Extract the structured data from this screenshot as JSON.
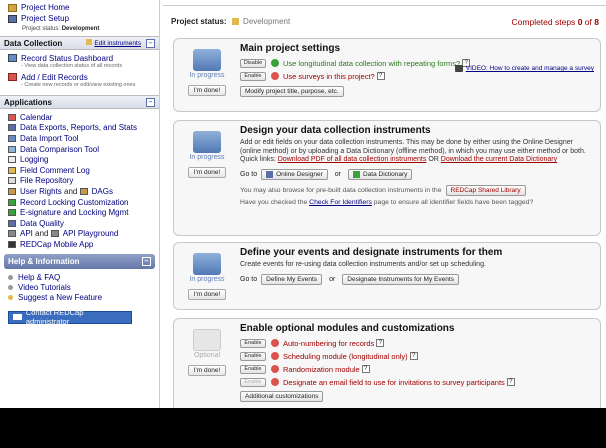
{
  "sidebar": {
    "top_links": [
      {
        "label": "Project Home",
        "icon": "home-icon"
      },
      {
        "label": "Project Setup",
        "icon": "setup-icon"
      }
    ],
    "project_status_label": "Project status:",
    "project_status_value": "Development",
    "data_collection": {
      "title": "Data Collection",
      "edit_link": "Edit instruments",
      "items": [
        {
          "label": "Record Status Dashboard",
          "sub": "- View data collection status of all records"
        },
        {
          "label": "Add / Edit Records",
          "sub": "- Create new records or edit/view existing ones"
        }
      ]
    },
    "applications": {
      "title": "Applications",
      "items": [
        {
          "label": "Calendar"
        },
        {
          "label": "Data Exports, Reports, and Stats"
        },
        {
          "label": "Data Import Tool"
        },
        {
          "label": "Data Comparison Tool"
        },
        {
          "label": "Logging"
        },
        {
          "label": "Field Comment Log"
        },
        {
          "label": "File Repository"
        },
        {
          "label": "User Rights",
          "extra": "and",
          "extra2": "DAGs"
        },
        {
          "label": "Record Locking Customization"
        },
        {
          "label": "E-signature and Locking Mgmt"
        },
        {
          "label": "Data Quality"
        },
        {
          "label": "API",
          "extra": "and",
          "extra2": "API Playground"
        },
        {
          "label": "REDCap Mobile App"
        }
      ]
    },
    "help": {
      "title": "Help & Information",
      "items": [
        "Help & FAQ",
        "Video Tutorials",
        "Suggest a New Feature"
      ],
      "contact_button": "Contact REDCap administrator"
    }
  },
  "main": {
    "project_status_label": "Project status:",
    "project_status_value": "Development",
    "completed_steps_prefix": "Completed steps",
    "completed_steps_count": "0",
    "completed_steps_of": "of",
    "completed_steps_total": "8",
    "cards": [
      {
        "title": "Main project settings",
        "state": "In progress",
        "done_label": "I'm done!",
        "options": [
          {
            "button": "Disable",
            "text": "Use longitudinal data collection with repeating forms?",
            "status": "enabled"
          },
          {
            "button": "Enable",
            "text": "Use surveys in this project?",
            "status": "disabled"
          }
        ],
        "video_link": "VIDEO: How to create and manage a survey",
        "action_button": "Modify project title, purpose, etc."
      },
      {
        "title": "Design your data collection instruments",
        "state": "In progress",
        "done_label": "I'm done!",
        "paragraph_1": "Add or edit fields on your data collection instruments. This may be done by either using the Online Designer (online method) or by uploading a Data Dictionary (offline method), in which you may use either method or both. Quick links:",
        "link_pdf": "Download PDF of all data collection instruments",
        "or_text": "OR",
        "link_dd": "Download the current Data Dictionary",
        "goto_label": "Go to",
        "online_designer": "Online Designer",
        "or_label": "or",
        "data_dictionary": "Data Dictionary",
        "library_text": "You may also browse for pre-built data collection instruments in the",
        "library_button": "REDCap Shared Library",
        "identifiers_prefix": "Have you checked the",
        "identifiers_link": "Check For Identifiers",
        "identifiers_suffix": "page to ensure all identifier fields have been tagged?"
      },
      {
        "title": "Define your events and designate instruments for them",
        "state": "In progress",
        "done_label": "I'm done!",
        "paragraph": "Create events for re-using data collection instruments and/or set up scheduling.",
        "goto_label": "Go to",
        "define_events": "Define My Events",
        "or_label": "or",
        "designate": "Designate Instruments for My Events"
      },
      {
        "title": "Enable optional modules and customizations",
        "state": "Optional",
        "done_label": "I'm done!",
        "options": [
          {
            "button": "Enable",
            "text": "Auto-numbering for records"
          },
          {
            "button": "Enable",
            "text": "Scheduling module (longitudinal only)"
          },
          {
            "button": "Enable",
            "text": "Randomization module"
          },
          {
            "button": "Enable",
            "text": "Designate an email field to use for invitations to survey participants"
          }
        ],
        "action_button": "Additional customizations"
      }
    ]
  }
}
